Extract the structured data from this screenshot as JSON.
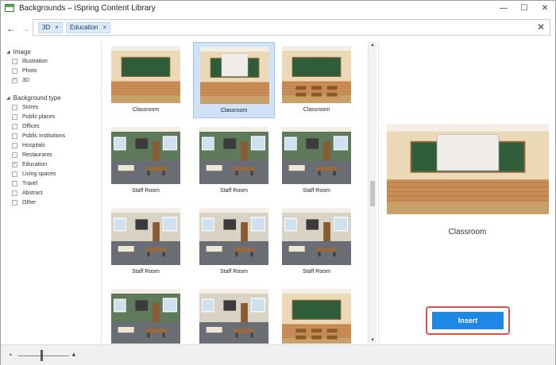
{
  "window": {
    "title": "Backgrounds – iSpring Content Library",
    "controls": {
      "minimize": "—",
      "maximize": "☐",
      "close": "✕"
    }
  },
  "nav": {
    "back": "←",
    "forward": "→"
  },
  "search": {
    "tags": [
      {
        "label": "3D"
      },
      {
        "label": "Education"
      }
    ],
    "tag_remove": "×",
    "clear": "✕"
  },
  "filters": {
    "image": {
      "title": "Image",
      "options": [
        {
          "label": "Illustration",
          "checked": false
        },
        {
          "label": "Photo",
          "checked": false
        },
        {
          "label": "3D",
          "checked": true
        }
      ]
    },
    "background_type": {
      "title": "Background type",
      "options": [
        {
          "label": "Stores",
          "checked": false
        },
        {
          "label": "Public places",
          "checked": false
        },
        {
          "label": "Offices",
          "checked": false
        },
        {
          "label": "Public institutions",
          "checked": false
        },
        {
          "label": "Hospitals",
          "checked": false
        },
        {
          "label": "Restaurants",
          "checked": false
        },
        {
          "label": "Education",
          "checked": true
        },
        {
          "label": "Living spaces",
          "checked": false
        },
        {
          "label": "Travel",
          "checked": false
        },
        {
          "label": "Abstract",
          "checked": false
        },
        {
          "label": "Other",
          "checked": false
        }
      ]
    }
  },
  "grid": {
    "items": [
      {
        "caption": "Classroom",
        "scene": "classroom",
        "selected": false
      },
      {
        "caption": "Classroom",
        "scene": "classroom-screen",
        "selected": true
      },
      {
        "caption": "Classroom",
        "scene": "classroom-wide",
        "selected": false
      },
      {
        "caption": "Staff Room",
        "scene": "staff-green",
        "selected": false
      },
      {
        "caption": "Staff Room",
        "scene": "staff-green",
        "selected": false
      },
      {
        "caption": "Staff Room",
        "scene": "staff-green",
        "selected": false
      },
      {
        "caption": "Staff Room",
        "scene": "staff-beige",
        "selected": false
      },
      {
        "caption": "Staff Room",
        "scene": "staff-beige",
        "selected": false
      },
      {
        "caption": "Staff Room",
        "scene": "staff-beige",
        "selected": false
      },
      {
        "caption": "",
        "scene": "staff-green",
        "selected": false
      },
      {
        "caption": "",
        "scene": "staff-beige",
        "selected": false
      },
      {
        "caption": "",
        "scene": "classroom-wide",
        "selected": false
      }
    ]
  },
  "preview": {
    "caption": "Classroom",
    "insert_label": "Insert"
  },
  "zoom": {
    "small_icon": "▲",
    "large_icon": "▲"
  },
  "colors": {
    "accent": "#1e88e5",
    "highlight": "#d9534f",
    "selection": "#cfe2f8"
  }
}
